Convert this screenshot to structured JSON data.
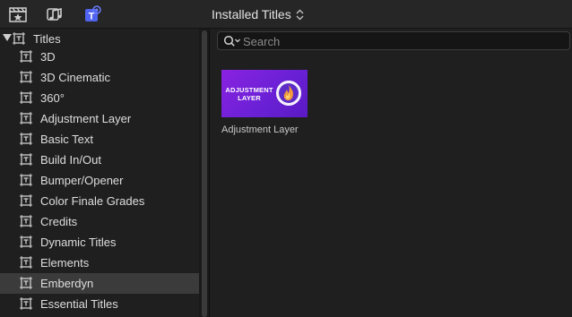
{
  "toolbar": {
    "icons": [
      {
        "name": "clapper-star-icon",
        "color": "#cfcfcf"
      },
      {
        "name": "music-note-icon",
        "color": "#cfcfcf"
      },
      {
        "name": "titles-t-icon",
        "color": "#6a7bff"
      }
    ],
    "browser_title": "Installed Titles"
  },
  "sidebar": {
    "root_label": "Titles",
    "items": [
      {
        "label": "3D",
        "selected": false
      },
      {
        "label": "3D Cinematic",
        "selected": false
      },
      {
        "label": "360°",
        "selected": false
      },
      {
        "label": "Adjustment Layer",
        "selected": false
      },
      {
        "label": "Basic Text",
        "selected": false
      },
      {
        "label": "Build In/Out",
        "selected": false
      },
      {
        "label": "Bumper/Opener",
        "selected": false
      },
      {
        "label": "Color Finale Grades",
        "selected": false
      },
      {
        "label": "Credits",
        "selected": false
      },
      {
        "label": "Dynamic Titles",
        "selected": false
      },
      {
        "label": "Elements",
        "selected": false
      },
      {
        "label": "Emberdyn",
        "selected": true
      },
      {
        "label": "Essential Titles",
        "selected": false
      }
    ]
  },
  "search": {
    "placeholder": "Search",
    "value": ""
  },
  "results": [
    {
      "thumbnail_lines": [
        "ADJUSTMENT",
        "LAYER"
      ],
      "caption": "Adjustment Layer",
      "thumbnail_color": "#7a22dc"
    }
  ]
}
